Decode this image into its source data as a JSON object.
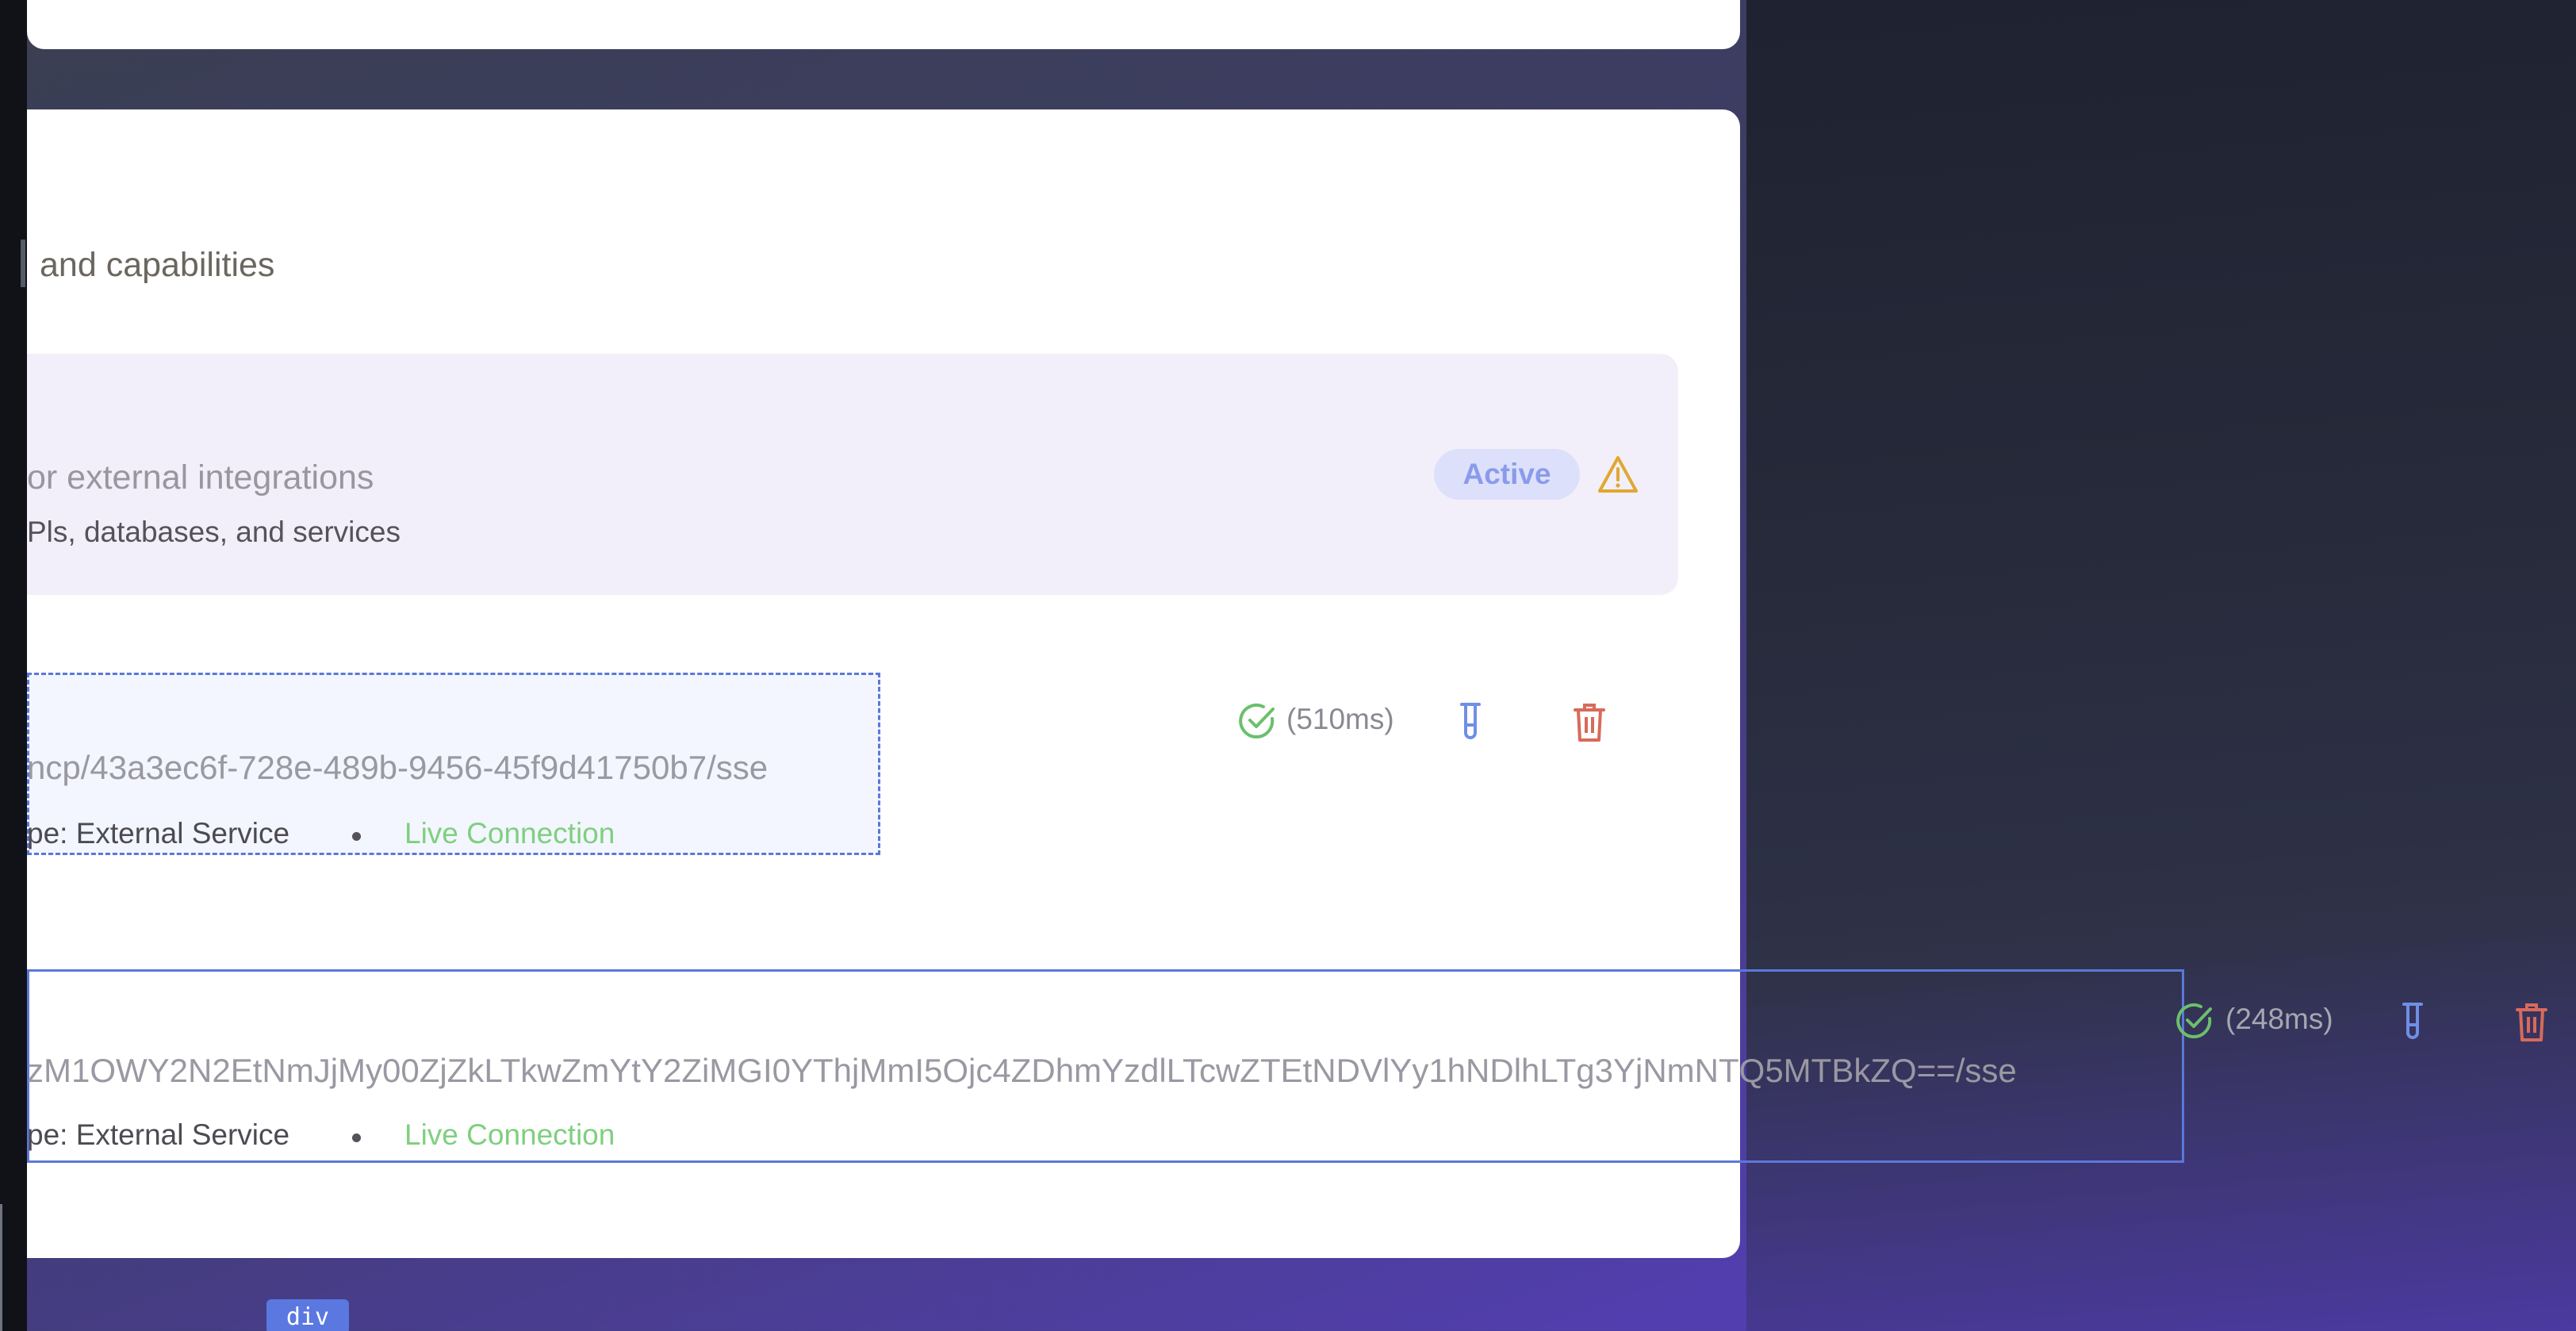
{
  "page": {
    "subtitle": "and capabilities"
  },
  "server": {
    "description": "or external integrations",
    "subdescription": "Pls, databases, and services",
    "status_label": "Active"
  },
  "connections": [
    {
      "url": "ncp/43a3ec6f-728e-489b-9456-45f9d41750b7/sse",
      "type_label": "pe: External Service",
      "connection_label": "Live Connection",
      "latency": "(510ms)"
    },
    {
      "url": "zM1OWY2N2EtNmJjMy00ZjZkLTkwZmYtY2ZiMGI0YThjMmI5Ojc4ZDhmYzdlLTcwZTEtNDVlYy1hNDlhLTg3YjNmNTQ5MTBkZQ==/sse",
      "type_label": "pe: External Service",
      "connection_label": "Live Connection",
      "latency": "(248ms)"
    }
  ],
  "devtools": {
    "element_tag": "div"
  },
  "colors": {
    "accent": "#5b78d9",
    "success": "#6cbf6c",
    "warning": "#e0a830",
    "danger": "#d86a5a",
    "badge_bg": "#dde0fb"
  },
  "icons": {
    "status_ok": "check-circle-icon",
    "warning": "warning-triangle-icon",
    "test": "test-tube-icon",
    "delete": "trash-icon"
  }
}
